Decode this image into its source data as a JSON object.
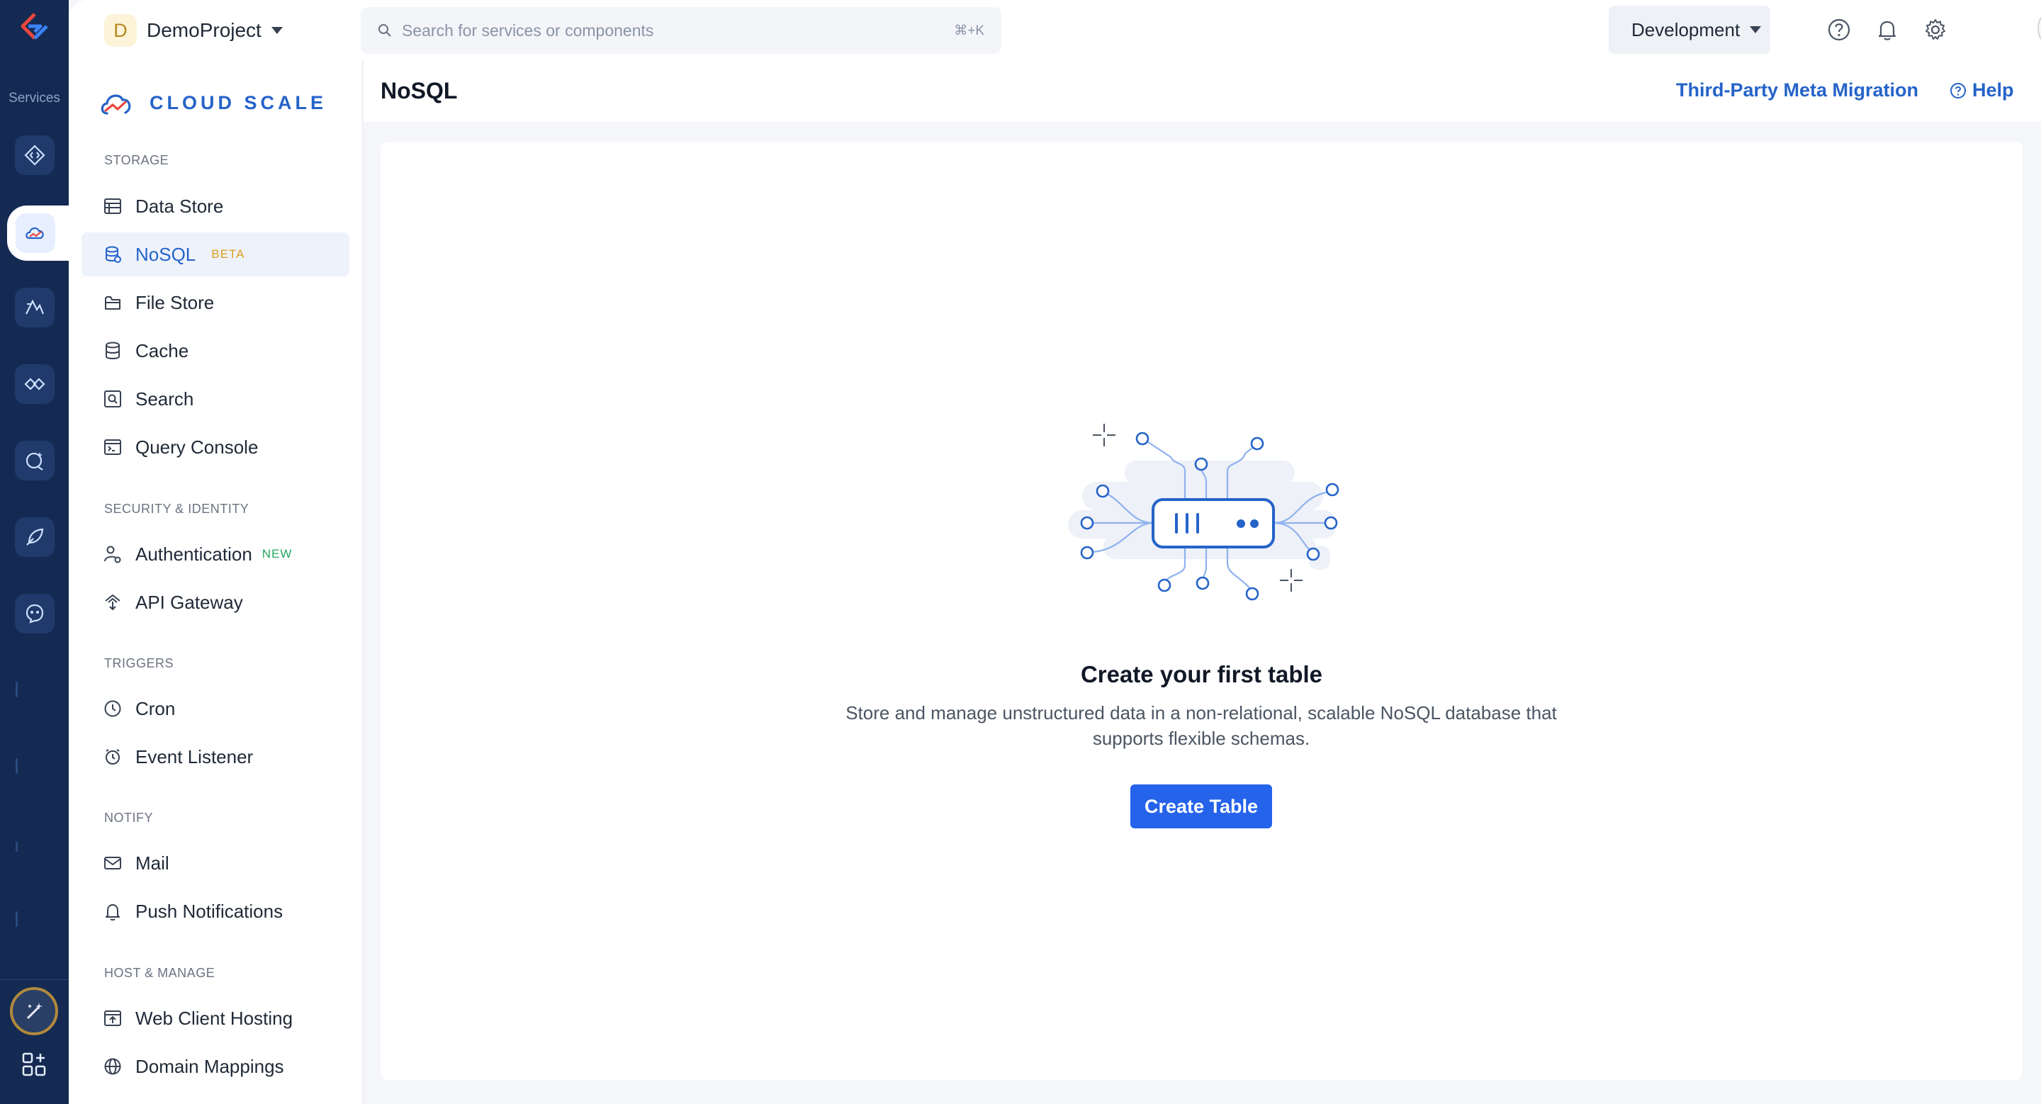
{
  "rail": {
    "label": "Services"
  },
  "topbar": {
    "project_initial": "D",
    "project_name": "DemoProject",
    "search_placeholder": "Search for services or components",
    "search_shortcut": "⌘+K",
    "environment": "Development"
  },
  "sidebar": {
    "brand": "CLOUD SCALE",
    "sections": {
      "storage": "STORAGE",
      "security": "SECURITY & IDENTITY",
      "triggers": "TRIGGERS",
      "notify": "NOTIFY",
      "host": "HOST & MANAGE"
    },
    "items": {
      "data_store": "Data Store",
      "nosql": "NoSQL",
      "nosql_tag": "BETA",
      "file_store": "File Store",
      "cache": "Cache",
      "search": "Search",
      "query_console": "Query Console",
      "authentication": "Authentication",
      "authentication_tag": "NEW",
      "api_gateway": "API Gateway",
      "cron": "Cron",
      "event_listener": "Event Listener",
      "mail": "Mail",
      "push_notifications": "Push Notifications",
      "web_client_hosting": "Web Client Hosting",
      "domain_mappings": "Domain Mappings"
    }
  },
  "header": {
    "title": "NoSQL",
    "migration_link": "Third-Party Meta Migration",
    "help_link": "Help"
  },
  "empty_state": {
    "title": "Create your first table",
    "description": "Store and manage unstructured data in a non-relational, scalable NoSQL database that supports flexible schemas.",
    "button": "Create Table"
  },
  "colors": {
    "accent": "#2563eb",
    "brand_blue": "#2563c9",
    "rail_bg": "#142a52",
    "beta": "#d9a01f",
    "new": "#22a55a"
  }
}
